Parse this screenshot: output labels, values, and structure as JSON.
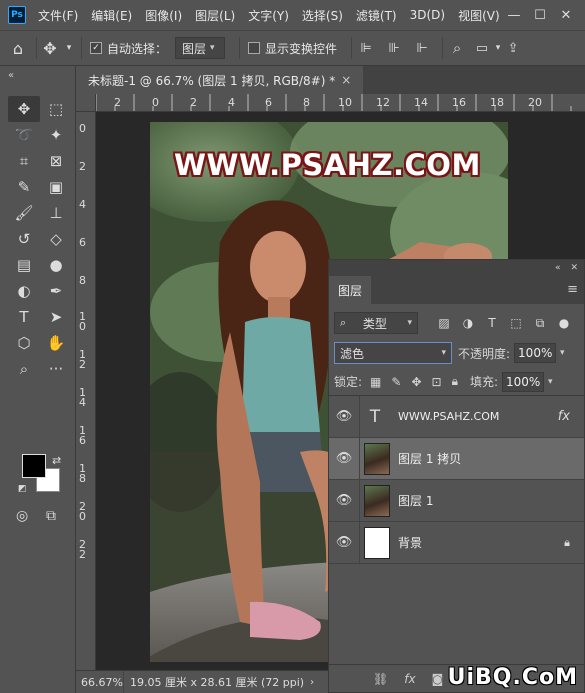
{
  "app": {
    "logo": "Ps",
    "menu": [
      "文件(F)",
      "编辑(E)",
      "图像(I)",
      "图层(L)",
      "文字(Y)",
      "选择(S)",
      "滤镜(T)",
      "3D(D)",
      "视图(V)"
    ]
  },
  "options": {
    "auto_select_label": "自动选择：",
    "auto_select_target": "图层",
    "show_transform_label": "显示变换控件"
  },
  "document": {
    "tab_title": "未标题-1 @ 66.7% (图层 1 拷贝, RGB/8#) *",
    "close": "×",
    "watermark": "WWW.PSAHZ.COM"
  },
  "rulers": {
    "top": [
      "2",
      "0",
      "2",
      "4",
      "6",
      "8",
      "10",
      "12",
      "14",
      "16",
      "18",
      "20"
    ],
    "left": [
      "0",
      "2",
      "4",
      "6",
      "8",
      "1\n0",
      "1\n2",
      "1\n4",
      "1\n6",
      "1\n8",
      "2\n0",
      "2\n2"
    ]
  },
  "status": {
    "zoom": "66.67%",
    "doc_info": "19.05 厘米 x 28.61 厘米 (72 ppi)"
  },
  "layers_panel": {
    "tab": "图层",
    "filter_kind": "类型",
    "blend_mode": "滤色",
    "opacity_label": "不透明度:",
    "opacity_value": "100%",
    "lock_label": "锁定:",
    "fill_label": "填充:",
    "fill_value": "100%",
    "layers": [
      {
        "name": "WWW.PSAHZ.COM",
        "type": "text",
        "fx": "fx"
      },
      {
        "name": "图层 1 拷贝",
        "type": "image",
        "selected": true
      },
      {
        "name": "图层 1",
        "type": "image"
      },
      {
        "name": "背景",
        "type": "background"
      }
    ]
  },
  "site_watermark": "UiBQ.CoM",
  "colors": {
    "foreground": "#000000",
    "background": "#ffffff",
    "panel": "#535353",
    "canvas_bg": "#282828",
    "watermark_outline": "#7a1515"
  }
}
